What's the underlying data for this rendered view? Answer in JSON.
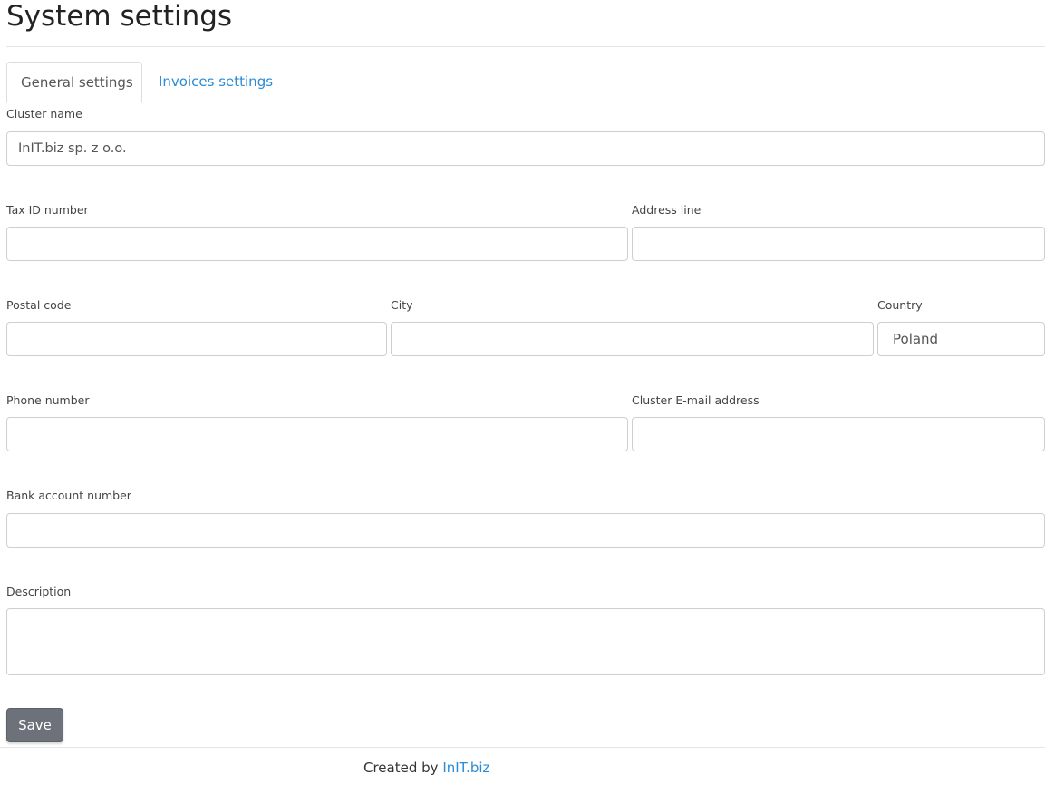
{
  "page": {
    "title": "System settings"
  },
  "tabs": [
    {
      "label": "General settings",
      "active": true
    },
    {
      "label": "Invoices settings",
      "active": false
    }
  ],
  "form": {
    "cluster_name": {
      "label": "Cluster name",
      "value": "InIT.biz sp. z o.o."
    },
    "tax_id": {
      "label": "Tax ID number",
      "value": ""
    },
    "address_line": {
      "label": "Address line",
      "value": ""
    },
    "postal_code": {
      "label": "Postal code",
      "value": ""
    },
    "city": {
      "label": "City",
      "value": ""
    },
    "country": {
      "label": "Country",
      "value": "Poland"
    },
    "phone": {
      "label": "Phone number",
      "value": ""
    },
    "email": {
      "label": "Cluster E-mail address",
      "value": ""
    },
    "bank_account": {
      "label": "Bank account number",
      "value": ""
    },
    "description": {
      "label": "Description",
      "value": ""
    }
  },
  "actions": {
    "save_label": "Save"
  },
  "footer": {
    "prefix": "Created by",
    "link_label": "InIT.biz"
  },
  "colors": {
    "link": "#2a8bd6",
    "button_bg": "#6c717a"
  }
}
